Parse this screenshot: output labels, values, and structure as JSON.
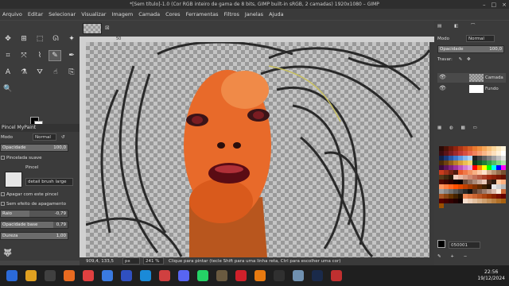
{
  "window": {
    "title": "*[Sem título]-1.0 (Cor RGB inteiro de gama de 8 bits, GIMP built-in sRGB, 2 camadas) 1920x1080 – GIMP"
  },
  "menu": [
    "Arquivo",
    "Editar",
    "Selecionar",
    "Visualizar",
    "Imagem",
    "Camada",
    "Cores",
    "Ferramentas",
    "Filtros",
    "Janelas",
    "Ajuda"
  ],
  "tool_options": {
    "panel_title": "Pincel MyPaint",
    "mode_label": "Modo",
    "mode_value": "Normal",
    "opacity_label": "Opacidade",
    "opacity_value": "100,0",
    "opacity_fraction": 1.0,
    "smooth_label": "Pincelada suave",
    "brush_label": "Pincel",
    "brush_name": "detail brush large",
    "erase_label": "Apagar com este pincel",
    "no_erase_label": "Sem efeito de apagamento",
    "radius_label": "Raio",
    "radius_value": "-0,79",
    "radius_fraction": 0.43,
    "base_opacity_label": "Opacidade base",
    "base_opacity_value": "0,79",
    "base_opacity_fraction": 0.79,
    "hardness_label": "Dureza",
    "hardness_value": "1,00",
    "hardness_fraction": 1.0
  },
  "ruler": {
    "mark_50": "50"
  },
  "status": {
    "coords": "909,4, 133,5",
    "unit": "px",
    "zoom": "241 %",
    "hint": "Clique para pintar (tecle Shift para uma linha reta, Ctrl para escolher uma cor)"
  },
  "layers": {
    "mode_label": "Modo",
    "mode_value": "Normal",
    "opacity_label": "Opacidade",
    "opacity_value": "100,0",
    "lock_label": "Travar:",
    "items": [
      {
        "name": "Camada"
      },
      {
        "name": "Fundo"
      }
    ]
  },
  "colors": {
    "hex_value": "050001",
    "accent": "#e06a2c",
    "palette": [
      "#2a0a06",
      "#4a1208",
      "#6e1a0c",
      "#8f2410",
      "#b03616",
      "#c84a1c",
      "#d86026",
      "#e87a30",
      "#f09040",
      "#f6a85a",
      "#f8c07a",
      "#fbd69a",
      "#fde8bc",
      "#fff4dc",
      "#3a0c10",
      "#5c1418",
      "#7e1e22",
      "#a02a2c",
      "#c03a36",
      "#d84e40",
      "#e8684c",
      "#f0825c",
      "#f49c70",
      "#f8b688",
      "#fbcca0",
      "#fde0bc",
      "#fff0d8",
      "#ffffff",
      "#10224a",
      "#1a3a7a",
      "#2a58a8",
      "#4078cc",
      "#6098e0",
      "#88b8ee",
      "#b0d4f6",
      "#202020",
      "#404040",
      "#606060",
      "#808080",
      "#a0a0a0",
      "#c0c0c0",
      "#e0e0e0",
      "#4a2a08",
      "#6e4210",
      "#94601a",
      "#ba8028",
      "#d8a03a",
      "#ecbe52",
      "#f6d670",
      "#0a3a1a",
      "#145c28",
      "#207e38",
      "#32a04a",
      "#52be62",
      "#7ed482",
      "#a8e4a4",
      "#3a0a3a",
      "#5c145c",
      "#7e207e",
      "#a032a0",
      "#be52be",
      "#d47ed4",
      "#e4a8e4",
      "#ff0000",
      "#ff8000",
      "#ffff00",
      "#00ff00",
      "#00ffff",
      "#0000ff",
      "#ff00ff",
      "#c83c1e",
      "#a0321a",
      "#782414",
      "#501a0e",
      "#e85c2c",
      "#f07848",
      "#f49464",
      "#f8b084",
      "#fccaa8",
      "#fee2cc",
      "#d8b090",
      "#b89070",
      "#987050",
      "#785030",
      "#583818",
      "#402810",
      "#281808",
      "#f4d0c0",
      "#e8b8a4",
      "#dca088",
      "#d08870",
      "#c47058",
      "#b85840",
      "#ac4028",
      "#a02810",
      "#8c2008",
      "#781804",
      "#641002",
      "#500801",
      "#3c0400",
      "#280200",
      "#140100",
      "#050001",
      "#6a4a3a",
      "#8a6a5a",
      "#aa8a7a",
      "#caaa9a",
      "#eacaba",
      "#4a2a1a",
      "#2a1a10",
      "#ffc8a0",
      "#ffb080",
      "#ff9860",
      "#ff8040",
      "#ff6820",
      "#ff5000",
      "#e04800",
      "#c04000",
      "#a03800",
      "#803000",
      "#602800",
      "#402000",
      "#201000",
      "#e8e8e8",
      "#d0d0d0",
      "#b8b8b8",
      "#a0a0a0",
      "#888888",
      "#707070",
      "#585858",
      "#404040",
      "#282828",
      "#101010",
      "#5a3a2a",
      "#7a5a4a",
      "#9a7a6a",
      "#ba9a8a",
      "#dabaaa",
      "#faeada",
      "#cc6633",
      "#aa5522",
      "#884411",
      "#663300",
      "#442200",
      "#221100",
      "#ee8855",
      "#dd7744",
      "#cc6633",
      "#bb5522",
      "#aa4411",
      "#993300",
      "#882200",
      "#771100",
      "#660000",
      "#550000",
      "#440000",
      "#330000",
      "#220000",
      "#110000",
      "#f6e0d0",
      "#ecd0b8",
      "#e2c0a0",
      "#d8b088",
      "#cea070",
      "#c49058",
      "#ba8040",
      "#b07028",
      "#a66010",
      "#9c5000"
    ]
  },
  "clock": {
    "time": "22:56",
    "date": "19/12/2024"
  },
  "taskbar": {
    "apps": [
      "launcher",
      "files",
      "terminal",
      "firefox",
      "chrome",
      "store",
      "store-alt",
      "edge",
      "mail",
      "discord",
      "whatsapp",
      "gimp",
      "opera",
      "blender",
      "obs",
      "settings",
      "steam",
      "video"
    ]
  }
}
